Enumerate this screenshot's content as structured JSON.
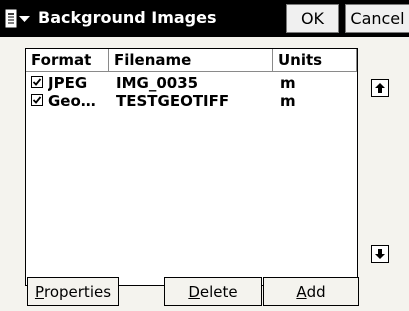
{
  "window": {
    "title": "Background Images",
    "ok_label": "OK",
    "cancel_label": "Cancel",
    "menu_icon": "window-menu-icon"
  },
  "list": {
    "columns": [
      "Format",
      "Filename",
      "Units"
    ],
    "rows": [
      {
        "checked": true,
        "format": "JPEG",
        "filename": "IMG_0035",
        "units": "m"
      },
      {
        "checked": true,
        "format": "Geo…",
        "filename": "TESTGEOTIFF",
        "units": "m"
      }
    ]
  },
  "scroll": {
    "up_icon": "arrow-up-icon",
    "down_icon": "arrow-down-icon"
  },
  "buttons": {
    "properties": {
      "mnemonic": "P",
      "rest": "roperties"
    },
    "delete": {
      "mnemonic": "D",
      "rest": "elete"
    },
    "add": {
      "mnemonic": "A",
      "rest": "dd"
    }
  }
}
